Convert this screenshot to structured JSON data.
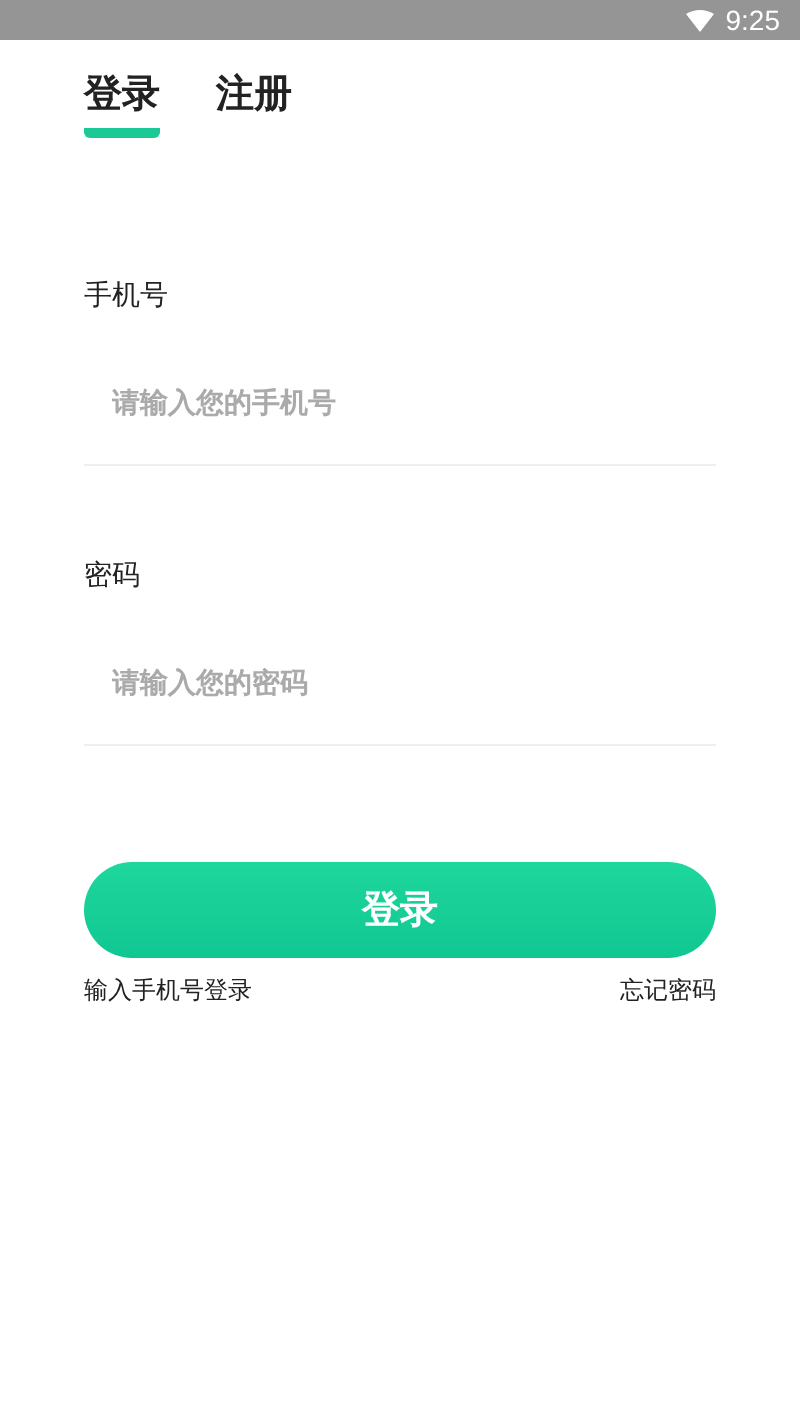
{
  "status_bar": {
    "time": "9:25"
  },
  "tabs": [
    {
      "label": "登录",
      "selected": true
    },
    {
      "label": "注册",
      "selected": false
    }
  ],
  "fields": [
    {
      "label": "手机号",
      "placeholder": "请输入您的手机号"
    },
    {
      "label": "密码",
      "placeholder": "请输入您的密码"
    }
  ],
  "submit": "登录",
  "links": {
    "left": "输入手机号登录",
    "right": "忘记密码"
  }
}
